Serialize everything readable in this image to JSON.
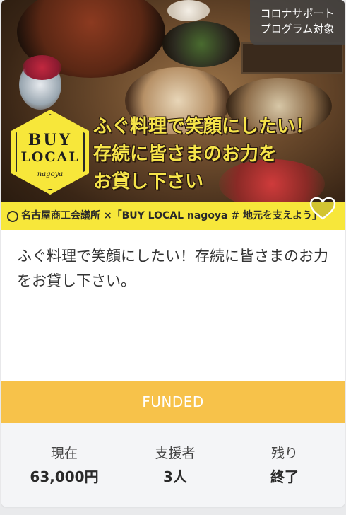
{
  "badge": {
    "line1": "コロナサポート",
    "line2": "プログラム対象"
  },
  "hero": {
    "logo": {
      "buy": "BUY",
      "local": "LOCAL",
      "nagoya": "nagoya"
    },
    "catchcopy": [
      "ふぐ料理で笑顔にしたい！",
      "存続に皆さまのお力を",
      "お貸し下さい"
    ],
    "footer_text": "名古屋商工会議所 ×「BUY LOCAL nagoya # 地元を支えよう」"
  },
  "project": {
    "title": "ふぐ料理で笑顔にしたい！存続に皆さまのお力をお貸し下さい。"
  },
  "status": {
    "label": "FUNDED"
  },
  "stats": [
    {
      "label": "現在",
      "value": "63,000円"
    },
    {
      "label": "支援者",
      "value": "3人"
    },
    {
      "label": "残り",
      "value": "終了"
    }
  ],
  "colors": {
    "accent_yellow": "#f7e73a",
    "funded_orange": "#f7c24a",
    "stats_bg": "#f4f5f7"
  },
  "icons": {
    "favorite": "heart-outline-icon"
  }
}
